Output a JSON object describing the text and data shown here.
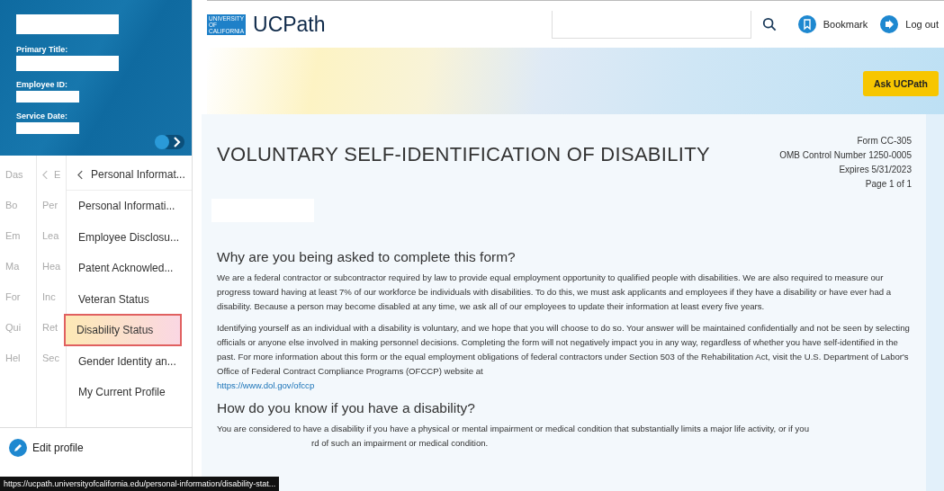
{
  "sidebar": {
    "profile_labels": [
      "Primary Title:",
      "Employee ID:",
      "Service Date:"
    ],
    "menu_columns": [
      {
        "header": "Das",
        "items": [
          "Bo",
          "Em",
          "Ma",
          "For",
          "Qui",
          "Hel"
        ]
      },
      {
        "header": "E",
        "items": [
          "Per",
          "Lea",
          "Hea",
          "Inc",
          "Ret",
          "Sec"
        ]
      }
    ],
    "submenu": {
      "title": "Personal Informat...",
      "items": [
        {
          "label": "Personal Informati...",
          "selected": false
        },
        {
          "label": "Employee Disclosu...",
          "selected": false
        },
        {
          "label": "Patent Acknowled...",
          "selected": false
        },
        {
          "label": "Veteran Status",
          "selected": false
        },
        {
          "label": "Disability Status",
          "selected": true
        },
        {
          "label": "Gender Identity an...",
          "selected": false
        },
        {
          "label": "My Current Profile",
          "selected": false
        }
      ]
    },
    "edit_profile": "Edit profile"
  },
  "header": {
    "logo_lines": [
      "UNIVERSITY",
      "OF",
      "CALIFORNIA"
    ],
    "app_name": "UCPath",
    "bookmark": "Bookmark",
    "logout": "Log out"
  },
  "ask_button": "Ask UCPath",
  "form": {
    "title": "VOLUNTARY SELF-IDENTIFICATION OF DISABILITY",
    "meta": [
      "Form CC-305",
      "OMB Control Number 1250-0005",
      "Expires 5/31/2023",
      "Page 1 of 1"
    ],
    "sections": [
      {
        "heading": "Why are you being asked to complete this form?",
        "paragraphs": [
          {
            "text": "We are a federal contractor or subcontractor required by law to provide equal employment opportunity to qualified people with disabilities. We are also required to measure our progress toward having at least 7% of our workforce be individuals with disabilities. To do this, we must ask applicants and employees if they have a disability or have ever had a disability. Because a person may become disabled at any time, we ask all of our employees to update their information at least every five years."
          },
          {
            "text": "Identifying yourself as an individual with a disability is voluntary, and we hope that you will choose to do so. Your answer will be maintained confidentially and not be seen by selecting officials or anyone else involved in making personnel decisions. Completing the form will not negatively impact you in any way, regardless of whether you have self-identified in the past. For more information about this form or the equal employment obligations of federal contractors under Section 503 of the Rehabilitation Act, visit the U.S. Department of Labor's Office of Federal Contract Compliance Programs (OFCCP) website at",
            "link": "https://www.dol.gov/ofccp"
          }
        ]
      },
      {
        "heading": "How do you know if you have a disability?",
        "paragraphs": [
          {
            "text": "You are considered to have a disability if you have a physical or mental impairment or medical condition that substantially limits a major life activity, or if you",
            "tail": "rd of such an impairment or medical condition."
          }
        ]
      }
    ]
  },
  "status_url": "https://ucpath.universityofcalifornia.edu/personal-information/disability-stat..."
}
